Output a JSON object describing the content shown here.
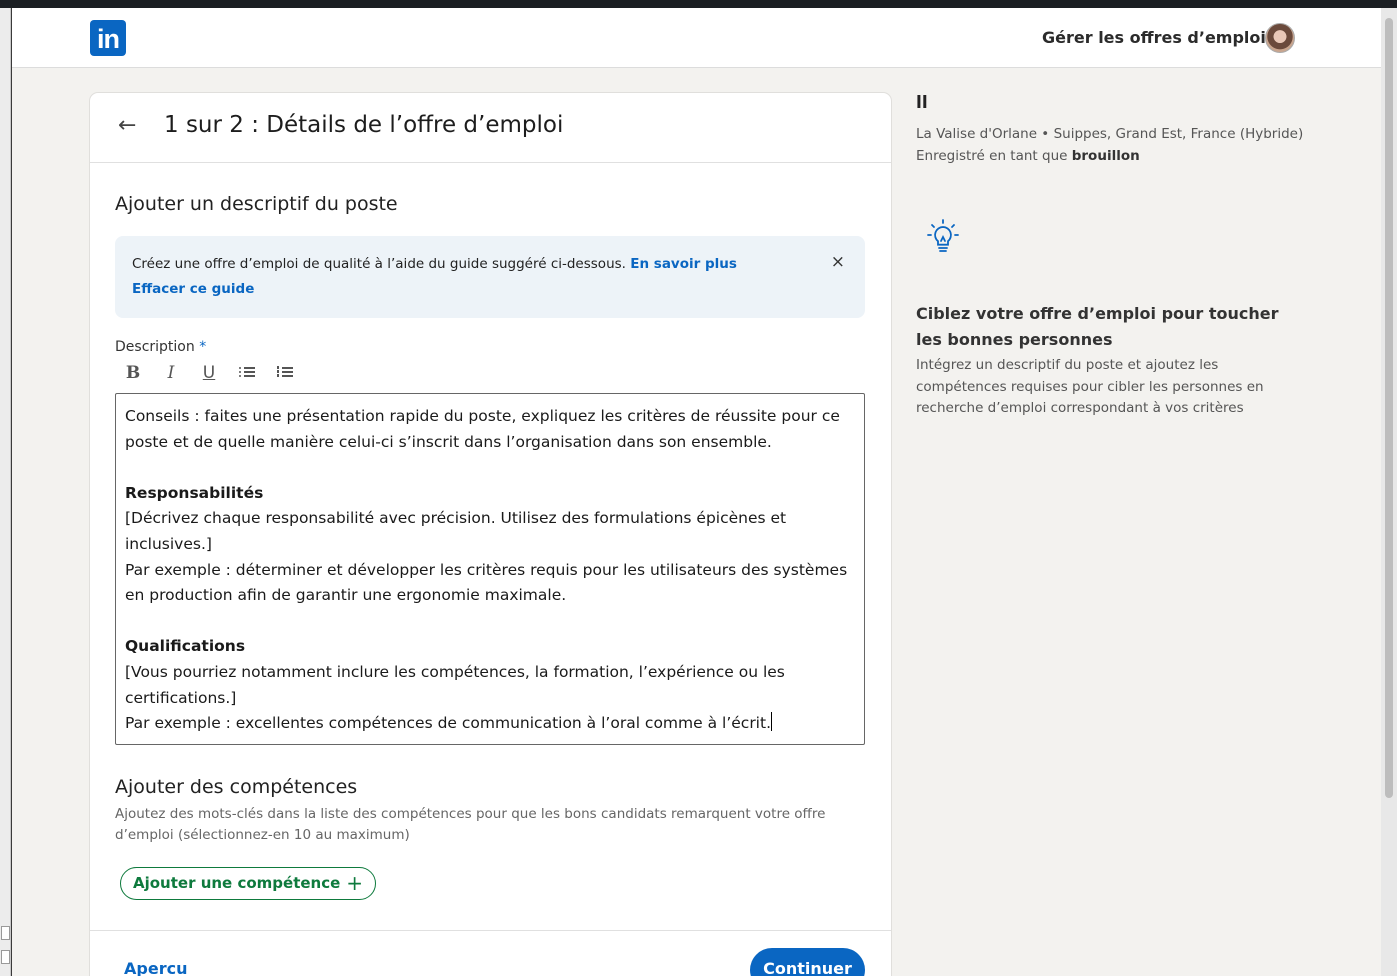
{
  "header": {
    "logo": "in",
    "manage_link": "Gérer les offres d’emploi"
  },
  "card": {
    "step_title": "1 sur 2 : Détails de l’offre d’emploi",
    "section_title": "Ajouter un descriptif du poste",
    "guide": {
      "text": "Créez une offre d’emploi de qualité à l’aide du guide suggéré ci-dessous.",
      "learn_more": "En savoir plus",
      "clear": "Effacer ce guide",
      "close": "×"
    },
    "description": {
      "label": "Description",
      "required_mark": "*",
      "toolbar": {
        "bold": "B",
        "italic": "I",
        "underline": "U"
      },
      "intro": "Conseils : faites une présentation rapide du poste, expliquez les critères de réussite pour ce poste et de quelle manière celui-ci s’inscrit dans l’organisation dans son ensemble.",
      "resp_heading": "Responsabilités",
      "resp_line1": "[Décrivez chaque responsabilité avec précision. Utilisez des formulations épicènes et inclusives.]",
      "resp_line2": "Par exemple : déterminer et développer les critères requis pour les utilisateurs des systèmes en production afin de garantir une ergonomie maximale.",
      "qual_heading": "Qualifications",
      "qual_line1": "[Vous pourriez notamment inclure les compétences, la formation, l’expérience ou les certifications.]",
      "qual_line2": "Par exemple : excellentes compétences de communication à l’oral comme à l’écrit."
    },
    "skills": {
      "title": "Ajouter des compétences",
      "help": "Ajoutez des mots-clés dans la liste des compétences pour que les bons candidats remarquent votre offre d’emploi (sélectionnez-en 10 au maximum)",
      "add_button": "Ajouter une compétence",
      "plus": "+"
    },
    "footer": {
      "preview": "Apercu",
      "continue": "Continuer"
    }
  },
  "sidebar": {
    "job_title": "ll",
    "company_location": "La Valise d'Orlane • Suippes, Grand Est, France (Hybride)",
    "saved_prefix": "Enregistré en tant que",
    "saved_state": "brouillon",
    "tip_title": "Ciblez votre offre d’emploi pour toucher les bonnes personnes",
    "tip_body": "Intégrez un descriptif du poste et ajoutez les compétences requises pour cibler les personnes en recherche d’emploi correspondant à vos critères"
  },
  "colors": {
    "brand_blue": "#0a66c2",
    "skill_green": "#0e7a3d",
    "page_bg": "#f3f2ef",
    "guide_bg": "#edf3f8"
  },
  "icons": [
    "back-arrow-icon",
    "close-icon",
    "bold-icon",
    "italic-icon",
    "underline-icon",
    "bulleted-list-icon",
    "numbered-list-icon",
    "plus-icon",
    "lightbulb-icon",
    "avatar"
  ]
}
